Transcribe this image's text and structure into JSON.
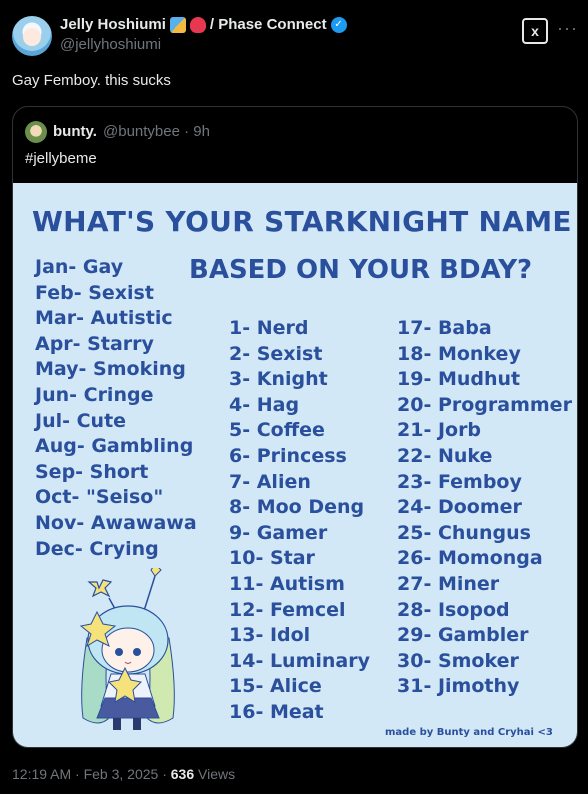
{
  "author": {
    "name": "Jelly Hoshiumi",
    "emoji_icons": [
      "rocket-icon",
      "ribbon-icon"
    ],
    "affiliation": "/ Phase Connect",
    "verified_icon": "verified-badge-icon",
    "handle": "@jellyhoshiumi"
  },
  "actions": {
    "grok_label": "x",
    "more_label": "···"
  },
  "tweet": {
    "text": "Gay Femboy. this sucks"
  },
  "quote": {
    "name": "bunty.",
    "handle": "@buntybee · 9h",
    "text": "#jellybeme",
    "image": {
      "title_line1": "WHAT'S YOUR STARKNIGHT NAME",
      "title_line2": "BASED ON YOUR BDAY?",
      "months": [
        "Jan- Gay",
        "Feb- Sexist",
        "Mar- Autistic",
        "Apr- Starry",
        "May- Smoking",
        "Jun- Cringe",
        "Jul- Cute",
        "Aug- Gambling",
        "Sep- Short",
        "Oct- \"Seiso\"",
        "Nov- Awawawa",
        "Dec- Crying"
      ],
      "days_col1": [
        "1- Nerd",
        "2- Sexist",
        "3- Knight",
        "4- Hag",
        "5- Coffee",
        "6- Princess",
        "7- Alien",
        "8- Moo Deng",
        "9- Gamer",
        "10- Star",
        "11- Autism",
        "12- Femcel",
        "13- Idol",
        "14- Luminary",
        "15- Alice",
        "16- Meat"
      ],
      "days_col2": [
        "17- Baba",
        "18- Monkey",
        "19- Mudhut",
        "20- Programmer",
        "21- Jorb",
        "22- Nuke",
        "23- Femboy",
        "24- Doomer",
        "25- Chungus",
        "26- Momonga",
        "27- Miner",
        "28- Isopod",
        "29- Gambler",
        "30- Smoker",
        "31- Jimothy"
      ],
      "credit": "made by Bunty and Cryhai <3"
    }
  },
  "meta": {
    "time": "12:19 AM · Feb 3, 2025 · ",
    "views_count": "636",
    "views_label": " Views"
  },
  "colors": {
    "background": "#000000",
    "card_bg": "#d2e8f6",
    "card_text": "#2a4f9c",
    "muted": "#71767b",
    "accent": "#1d9bf0"
  }
}
